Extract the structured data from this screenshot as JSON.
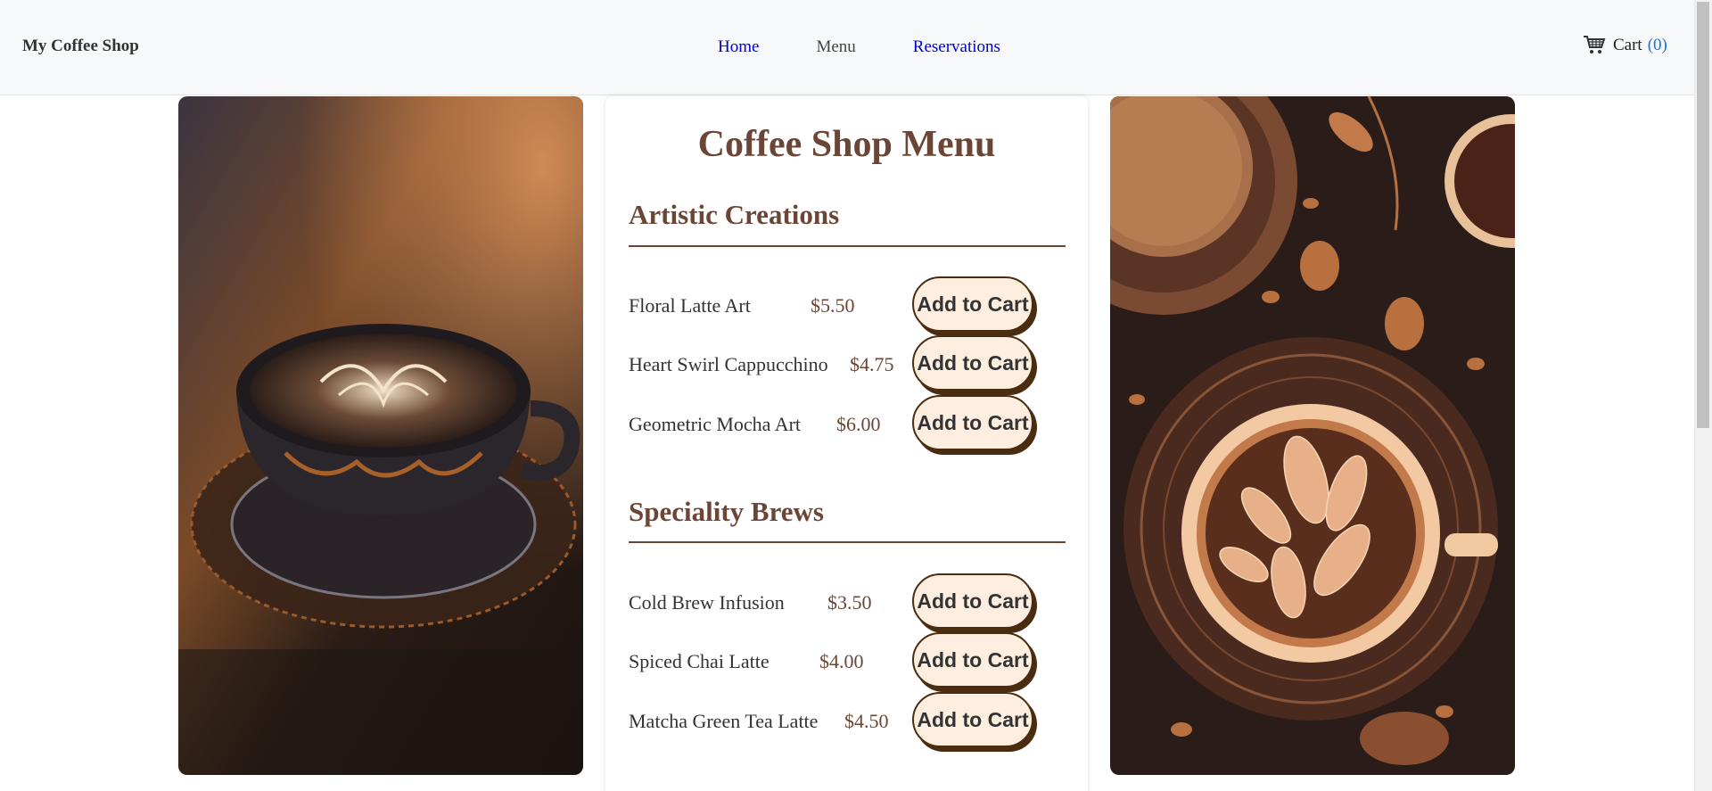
{
  "header": {
    "brand": "My Coffee Shop",
    "nav": [
      {
        "label": "Home"
      },
      {
        "label": "Menu"
      },
      {
        "label": "Reservations"
      }
    ],
    "cart": {
      "label": "Cart",
      "count": "(0)"
    }
  },
  "menu": {
    "title": "Coffee Shop Menu",
    "sections": [
      {
        "title": "Artistic Creations",
        "items": [
          {
            "name": "Floral Latte Art",
            "price": "$5.50",
            "button": "Add to Cart"
          },
          {
            "name": "Heart Swirl Cappucchino",
            "price": "$4.75",
            "button": "Add to Cart"
          },
          {
            "name": "Geometric Mocha Art",
            "price": "$6.00",
            "button": "Add to Cart"
          }
        ]
      },
      {
        "title": "Speciality Brews",
        "items": [
          {
            "name": "Cold Brew Infusion",
            "price": "$3.50",
            "button": "Add to Cart"
          },
          {
            "name": "Spiced Chai Latte",
            "price": "$4.00",
            "button": "Add to Cart"
          },
          {
            "name": "Matcha Green Tea Latte",
            "price": "$4.50",
            "button": "Add to Cart"
          }
        ]
      }
    ]
  },
  "images": {
    "left": "latte-art-cup-photo",
    "right": "leaf-latte-illustration"
  },
  "icons": {
    "cart": "shopping-cart-icon"
  },
  "colors": {
    "accent": "#6b4636",
    "button_bg": "#fdeee0",
    "button_border": "#4a2c10",
    "link": "#0000cc"
  }
}
